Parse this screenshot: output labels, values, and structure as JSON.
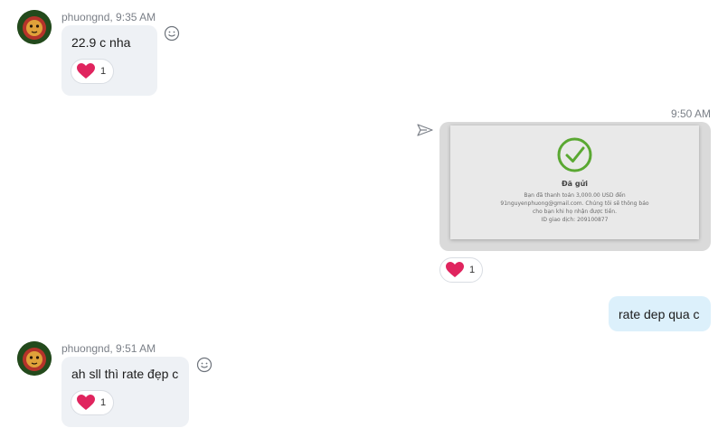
{
  "messages": [
    {
      "sender": "phuongnd",
      "time": "9:35 AM",
      "meta": "phuongnd, 9:35 AM",
      "text": "22.9  c nha",
      "reaction": {
        "icon": "heart-icon",
        "count": "1"
      }
    },
    {
      "direction": "outgoing",
      "time": "9:50 AM",
      "image": {
        "title": "Đã gửi",
        "lines": [
          "Bạn đã thanh toán 3,000.00 USD đến",
          "91nguyenphuong@gmail.com. Chúng tôi sẽ thông báo",
          "cho bạn khi họ nhận được tiền.",
          "ID giao dịch: 209100877"
        ]
      },
      "reaction": {
        "icon": "heart-icon",
        "count": "1"
      }
    },
    {
      "direction": "outgoing",
      "text": "rate dep qua c"
    },
    {
      "sender": "phuongnd",
      "time": "9:51 AM",
      "meta": "phuongnd, 9:51 AM",
      "text": "ah sll thì rate đẹp c",
      "reaction": {
        "icon": "heart-icon",
        "count": "1"
      }
    }
  ],
  "colors": {
    "heart": "#e0245e",
    "check": "#5aa832",
    "outgoing_bubble": "#dcf0fb",
    "incoming_bubble": "#eef1f5"
  }
}
